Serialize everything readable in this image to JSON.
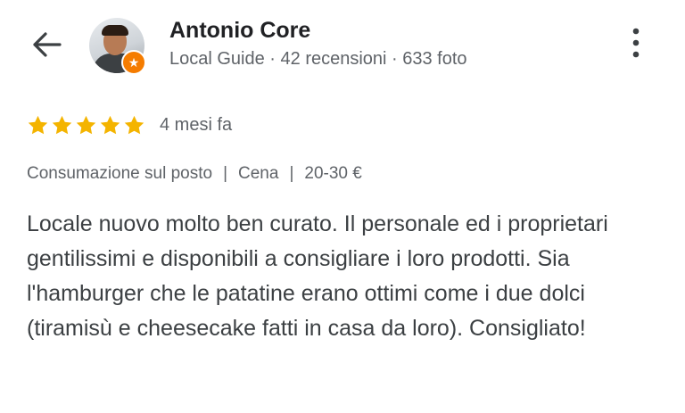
{
  "header": {
    "back_icon": "arrow-back-icon",
    "reviewer_name": "Antonio Core",
    "reviewer_meta": "Local Guide · 42 recensioni · 633 foto",
    "badge_icon": "local-guide-star-badge-icon",
    "more_icon": "more-vertical-icon"
  },
  "review": {
    "rating": 5,
    "rating_max": 5,
    "star_color": "#F4B400",
    "time_ago": "4 mesi fa",
    "tags": [
      "Consumazione sul posto",
      "Cena",
      "20-30 €"
    ],
    "tag_separator": "|",
    "text": "Locale nuovo molto ben curato. Il personale ed i proprietari gentilissimi e disponibili a consigliare i loro prodotti. Sia l'hamburger che le patatine erano ottimi come i due dolci (tiramisù e cheesecake fatti in casa da loro). Consigliato!"
  },
  "colors": {
    "primary_text": "#202124",
    "secondary_text": "#5f6368",
    "badge": "#F57C00"
  }
}
